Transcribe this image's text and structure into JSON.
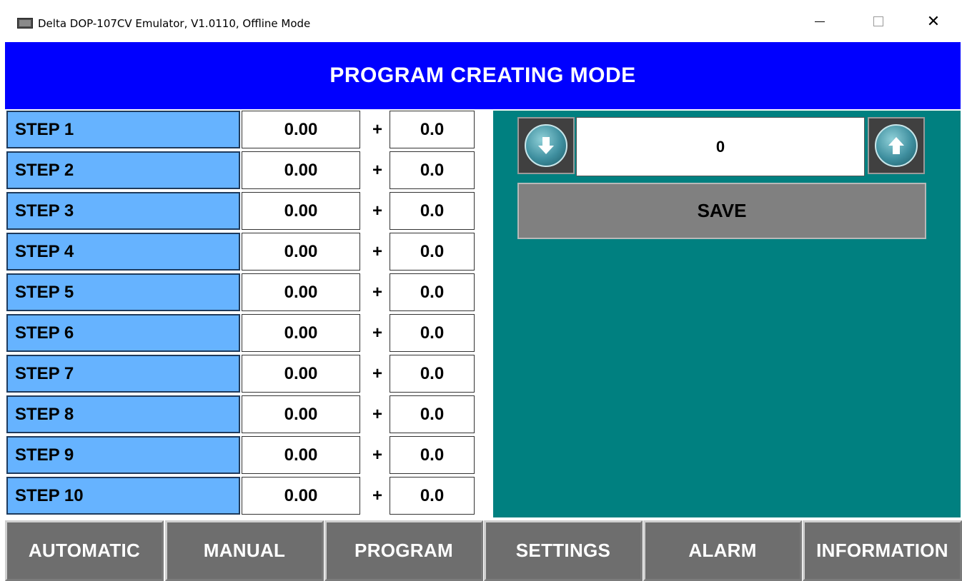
{
  "window": {
    "title": "Delta DOP-107CV Emulator, V1.0110, Offline Mode",
    "close_glyph": "✕"
  },
  "header": {
    "title": "PROGRAM CREATING MODE"
  },
  "steps": [
    {
      "label": "STEP 1",
      "value": "0.00",
      "plus": "+",
      "offset": "0.0"
    },
    {
      "label": "STEP 2",
      "value": "0.00",
      "plus": "+",
      "offset": "0.0"
    },
    {
      "label": "STEP 3",
      "value": "0.00",
      "plus": "+",
      "offset": "0.0"
    },
    {
      "label": "STEP 4",
      "value": "0.00",
      "plus": "+",
      "offset": "0.0"
    },
    {
      "label": "STEP 5",
      "value": "0.00",
      "plus": "+",
      "offset": "0.0"
    },
    {
      "label": "STEP 6",
      "value": "0.00",
      "plus": "+",
      "offset": "0.0"
    },
    {
      "label": "STEP 7",
      "value": "0.00",
      "plus": "+",
      "offset": "0.0"
    },
    {
      "label": "STEP 8",
      "value": "0.00",
      "plus": "+",
      "offset": "0.0"
    },
    {
      "label": "STEP 9",
      "value": "0.00",
      "plus": "+",
      "offset": "0.0"
    },
    {
      "label": "STEP 10",
      "value": "0.00",
      "plus": "+",
      "offset": "0.0"
    }
  ],
  "program_panel": {
    "number": "0",
    "save_label": "SAVE",
    "down_icon": "arrow-down-icon",
    "up_icon": "arrow-up-icon"
  },
  "nav": [
    {
      "label": "AUTOMATIC"
    },
    {
      "label": "MANUAL"
    },
    {
      "label": "PROGRAM"
    },
    {
      "label": "SETTINGS"
    },
    {
      "label": "ALARM"
    },
    {
      "label": "INFORMATION"
    }
  ],
  "colors": {
    "header_bg": "#0000ff",
    "step_label_bg": "#66b3ff",
    "panel_bg": "#008080",
    "button_gray": "#808080",
    "nav_bg": "#6e6e6e"
  }
}
